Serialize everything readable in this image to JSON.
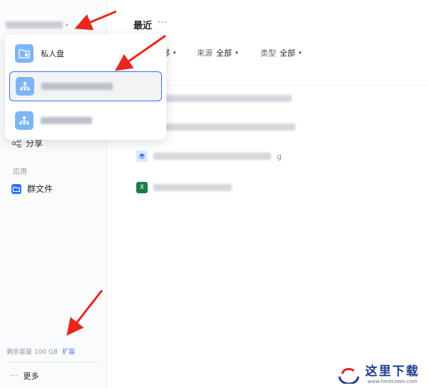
{
  "sidebar": {
    "space_switch_caret": "▾",
    "peek_item_label": "分享",
    "section_label": "应用",
    "apps": [
      {
        "label": "群文件"
      }
    ],
    "storage": {
      "text": "剩余容量 100 GB",
      "link_label": "扩容"
    },
    "more_label": "更多",
    "more_glyph": "···"
  },
  "dropdown": {
    "items": [
      {
        "label": "私人盘",
        "icon": "private-drive-icon",
        "selected": false
      },
      {
        "label": "",
        "icon": "org-drive-icon",
        "selected": true
      },
      {
        "label": "",
        "icon": "org-drive-icon",
        "selected": false
      }
    ]
  },
  "main": {
    "title": "最近",
    "title_more": "···",
    "filters": [
      {
        "label": "",
        "value": "部",
        "caret": "▾"
      },
      {
        "label": "来源",
        "value": "全部",
        "caret": "▾"
      },
      {
        "label": "类型",
        "value": "全部",
        "caret": "▾"
      }
    ],
    "files": [
      {
        "icon": "doc-icon",
        "name": ""
      },
      {
        "icon": "doc-icon",
        "name": ""
      },
      {
        "icon": "layers-icon",
        "name": "g"
      },
      {
        "icon": "excel-icon",
        "name": ""
      }
    ]
  },
  "watermark": {
    "cn": "这里下载",
    "en": "www.herecown.com"
  },
  "colors": {
    "accent": "#3370ff",
    "arrow": "#e8261d",
    "drive_icon": "#7db5f5",
    "excel": "#1f7a45"
  }
}
